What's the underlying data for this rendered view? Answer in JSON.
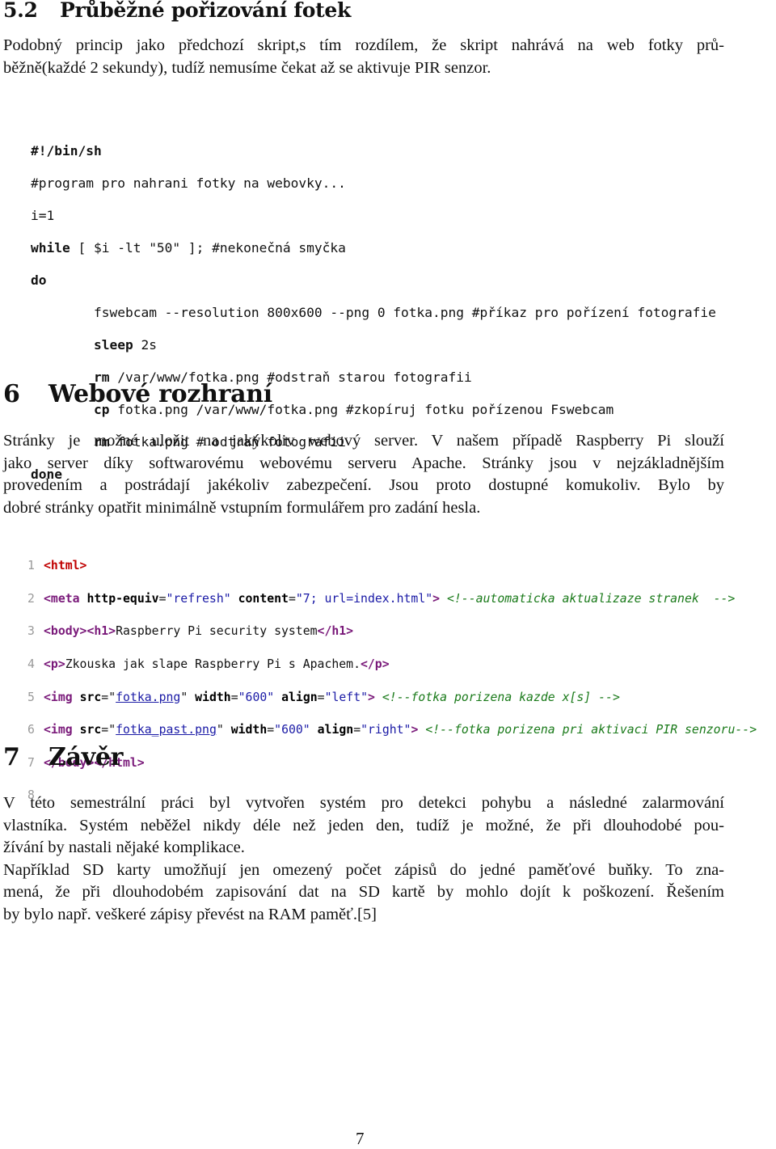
{
  "section_5_2": {
    "number": "5.2",
    "title": "Průběžné pořizování fotek",
    "paragraph_lines": [
      "Podobný princip jako předchozí skript,s tím rozdílem, že skript nahrává na web fotky prů-",
      "běžně(každé 2 sekundy), tudíž nemusíme čekat až se aktivuje PIR senzor."
    ]
  },
  "script": {
    "lines": [
      {
        "kw": "#!/bin/sh",
        "rest": ""
      },
      {
        "kw": "",
        "rest": "#program pro nahrani fotky na webovky..."
      },
      {
        "kw": "",
        "rest": "i=1"
      },
      {
        "kw": "while",
        "rest": " [ $i -lt \"50\" ]; #nekonečná smyčka"
      },
      {
        "kw": "do",
        "rest": ""
      },
      {
        "indent": "        ",
        "kw": "",
        "rest": "fswebcam --resolution 800x600 --png 0 fotka.png #příkaz pro pořízení fotografie"
      },
      {
        "indent": "        ",
        "kw": "sleep",
        "rest": " 2s"
      },
      {
        "indent": "        ",
        "kw": "rm",
        "rest": " /var/www/fotka.png #odstraň starou fotografii"
      },
      {
        "indent": "        ",
        "kw": "cp",
        "rest": " fotka.png /var/www/fotka.png #zkopíruj fotku pořízenou Fswebcam"
      },
      {
        "indent": "        ",
        "kw": "rm",
        "rest": " fotka.png # odtraň fotografii"
      },
      {
        "kw": "done",
        "rest": ""
      }
    ]
  },
  "section_6": {
    "number": "6",
    "title": "Webové rozhraní",
    "paragraph_lines": [
      "Stránky je možné uložit na jakýkoliv webový server. V našem případě Raspberry Pi slouží",
      "jako server díky softwarovému webovému serveru Apache. Stránky jsou v nejzákladnějším",
      "provedením a postrádají jakékoliv zabezpečení. Jsou proto dostupné komukoliv. Bylo by",
      "dobré stránky opatřit minimálně vstupním formulářem pro zadání hesla."
    ]
  },
  "html_listing": {
    "line_numbers": [
      "1",
      "2",
      "3",
      "4",
      "5",
      "6",
      "7",
      "8"
    ],
    "l1": {
      "tag": "<html>"
    },
    "l2": {
      "open": "<meta",
      "a1": "http-equiv",
      "eq": "=",
      "v1": "\"refresh\"",
      "a2": "content",
      "v2": "\"7; url=index.html\"",
      "close": ">",
      "comment": "<!--automaticka aktualizaze stranek  -->"
    },
    "l3": {
      "t1": "<body>",
      "t2": "<h1>",
      "text": "Raspberry Pi security system",
      "t3": "</h1>"
    },
    "l4": {
      "t1": "<p>",
      "text": "Zkouska jak slape Raspberry Pi s Apachem.",
      "t2": "</p>"
    },
    "l5": {
      "open": "<img",
      "a1": "src",
      "q": "\"",
      "link": "fotka.png",
      "a2": "width",
      "v2": "\"600\"",
      "a3": "align",
      "v3": "\"left\"",
      "close": ">",
      "comment": "<!--fotka porizena kazde x[s] -->"
    },
    "l6": {
      "open": "<img",
      "a1": "src",
      "q": "\"",
      "link": "fotka_past.png",
      "a2": "width",
      "v2": "\"600\"",
      "a3": "align",
      "v3": "\"right\"",
      "close": ">",
      "comment": "<!--fotka porizena pri aktivaci PIR senzoru-->"
    },
    "l7": {
      "t1": "</body>",
      "t2": "</html>"
    }
  },
  "section_7": {
    "number": "7",
    "title": "Závěr",
    "paragraph_lines": [
      "V této semestrální práci byl vytvořen systém pro detekci pohybu a následné zalarmování",
      "vlastníka. Systém neběžel nikdy déle než jeden den, tudíž je možné, že při dlouhodobé pou-",
      "žívání by nastali nějaké komplikace.",
      "Například SD karty umožňují jen omezený počet zápisů do jedné paměťové buňky. To zna-",
      "mená, že při dlouhodobém zapisování dat na SD kartě by mohlo dojít k poškození. Řešením",
      "by bylo např. veškeré zápisy převést na RAM paměť.[5]"
    ]
  },
  "page_number": "7"
}
